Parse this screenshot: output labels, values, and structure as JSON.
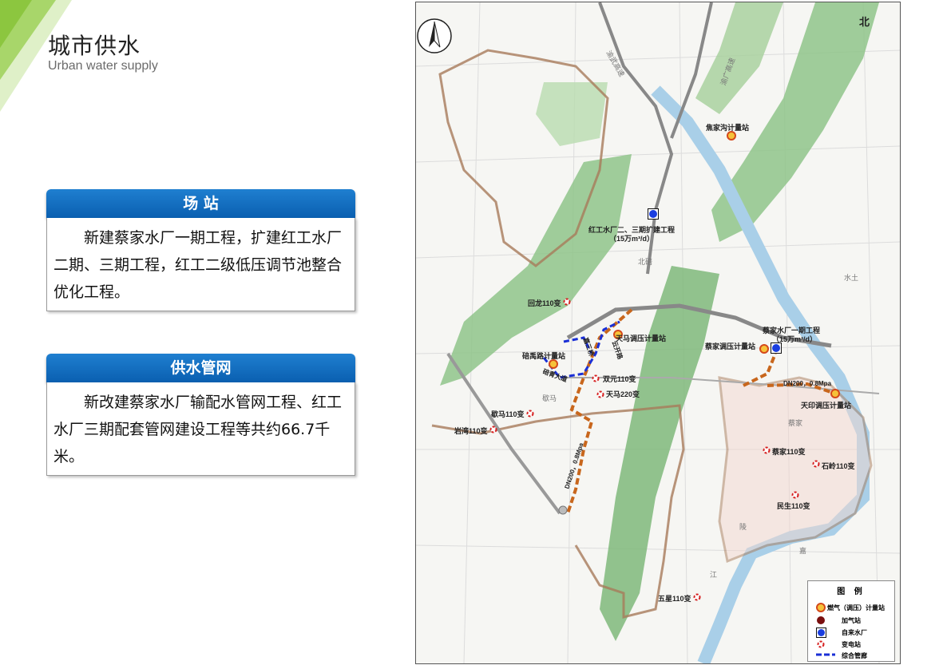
{
  "header": {
    "title": "城市供水",
    "subtitle": "Urban water supply"
  },
  "panels": [
    {
      "heading": "场 站",
      "body": "新建蔡家水厂一期工程，扩建红工水厂二期、三期工程，红工二级低压调节池整合优化工程。"
    },
    {
      "heading": "供水管网",
      "body": "新改建蔡家水厂输配水管网工程、红工水厂三期配套管网建设工程等共约66.7千米。"
    }
  ],
  "map": {
    "compass_label": "北",
    "highways": [
      "渝武高速",
      "渝广高速"
    ],
    "water_plants": [
      {
        "name": "红工水厂二、三期扩建工程",
        "capacity": "（15万m³/d）"
      },
      {
        "name": "蔡家水厂一期工程",
        "capacity": "（15万m³/d）"
      }
    ],
    "metering_stations": [
      "焦家沟计量站",
      "天马调压计量站",
      "碚禹路计量站",
      "蔡家调压计量站",
      "天印调压计量站"
    ],
    "substations": [
      "回龙110变",
      "双元110变",
      "天马220变",
      "歇马110变",
      "岩湾110变",
      "蔡家110变",
      "石岭110变",
      "民生110变",
      "五星110变"
    ],
    "place_names": [
      "北碚",
      "歇马",
      "蔡家",
      "水土",
      "陵",
      "嘉",
      "江"
    ],
    "pipe_labels": [
      "DN200，0.8Mpa",
      "DN200，0.8Mpa"
    ],
    "road_labels": [
      "碚青大道",
      "云开路",
      "嘉三桥"
    ]
  },
  "legend": {
    "title": "图 例",
    "items": [
      {
        "label": "燃气（调压）计量站",
        "icon": "metering-station-icon"
      },
      {
        "label": "加气站",
        "icon": "gas-station-icon"
      },
      {
        "label": "自来水厂",
        "icon": "water-plant-icon"
      },
      {
        "label": "变电站",
        "icon": "substation-icon"
      },
      {
        "label": "综合管廊",
        "icon": "utility-tunnel-icon"
      }
    ]
  },
  "colors": {
    "accent_blue": "#0a5fb0",
    "pipe_orange": "#c8661c",
    "tunnel_blue": "#1a2fd6",
    "mountain_green": "#7fb87a",
    "boundary_brown": "#a87a5a",
    "river_blue": "#a9cfe8",
    "corner_green": "#8cc63f"
  }
}
